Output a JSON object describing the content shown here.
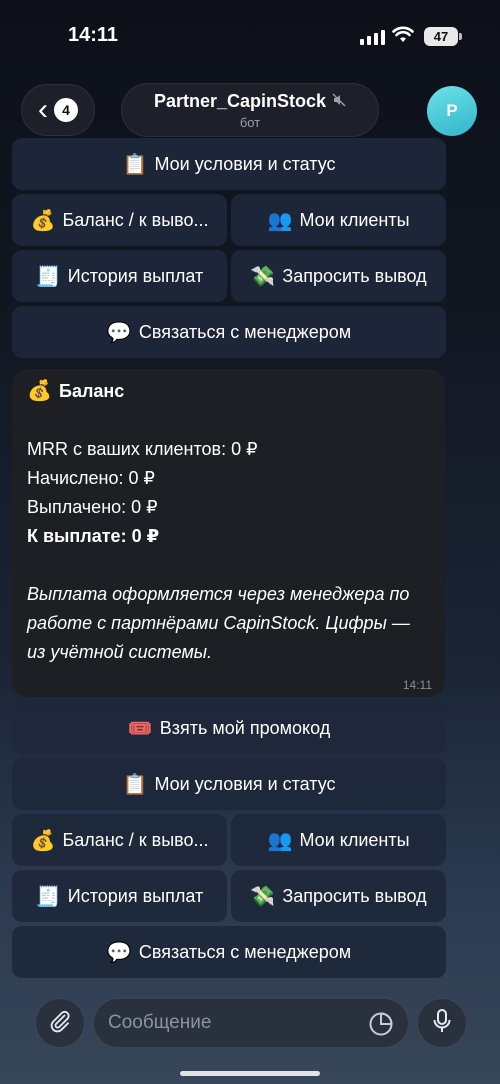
{
  "status_bar": {
    "time": "14:11",
    "battery": "47"
  },
  "header": {
    "back_count": "4",
    "title": "Partner_CapinStock",
    "subtitle": "бот",
    "avatar_letter": "P"
  },
  "keyboard_top": {
    "conditions": "Мои условия и статус",
    "balance": "Баланс / к выво...",
    "clients": "Мои клиенты",
    "history": "История выплат",
    "withdraw": "Запросить вывод",
    "contact": "Связаться с менеджером"
  },
  "message": {
    "title": "Баланс",
    "mrr": "MRR с ваших клиентов: 0 ₽",
    "accrued": "Начислено: 0 ₽",
    "paid": "Выплачено: 0 ₽",
    "to_pay": "К выплате: 0 ₽",
    "note": "Выплата оформляется через менеджера по работе с партнёрами CapinStock. Цифры — из учётной системы.",
    "time": "14:11"
  },
  "keyboard_bottom": {
    "promo": "Взять мой промокод",
    "conditions": "Мои условия и статус",
    "balance": "Баланс / к выво...",
    "clients": "Мои клиенты",
    "history": "История выплат",
    "withdraw": "Запросить вывод",
    "contact": "Связаться с менеджером"
  },
  "composer": {
    "placeholder": "Сообщение"
  },
  "icons": {
    "conditions": "clipboard-icon",
    "balance": "money-bag-icon",
    "clients": "users-icon",
    "history": "receipt-icon",
    "withdraw": "money-wings-icon",
    "contact": "speech-bubble-icon",
    "promo": "ticket-icon"
  }
}
